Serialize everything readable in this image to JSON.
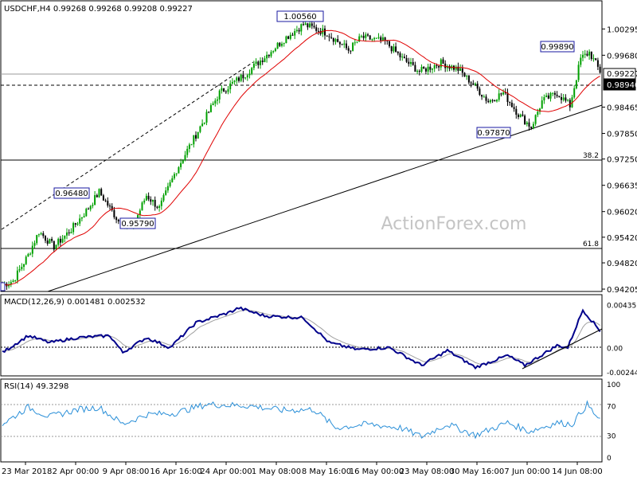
{
  "price_panel": {
    "symbol_title": "USDCHF,H4",
    "ohlc_text": "0.99268 0.99268 0.99208 0.99227",
    "price_ticks": [
      "1.00295",
      "0.99680",
      "0.99227",
      "0.98940",
      "0.98465",
      "0.97850",
      "0.97250",
      "0.96635",
      "0.96020",
      "0.95420",
      "0.94820",
      "0.94205"
    ],
    "current_price": "0.99227",
    "level_line_price": "0.98940",
    "fib_38": "38.2",
    "fib_61": "61.8",
    "callouts": [
      "1.00560",
      "0.99890",
      "0.96480",
      "0.95790",
      "0.97870"
    ],
    "watermark": "ActionForex.com"
  },
  "macd_panel": {
    "title": "MACD(12,26,9) 0.001481 0.002532",
    "ticks": [
      "0.004351",
      "0.00",
      "-0.002448"
    ]
  },
  "rsi_panel": {
    "title": "RSI(14) 49.3298",
    "ticks": [
      "100",
      "70",
      "30",
      "0"
    ]
  },
  "time_axis": [
    "23 Mar 2018",
    "2 Apr 00:00",
    "9 Apr 08:00",
    "16 Apr 16:00",
    "24 Apr 00:00",
    "1 May 08:00",
    "8 May 16:00",
    "16 May 00:00",
    "23 May 08:00",
    "30 May 16:00",
    "7 Jun 00:00",
    "14 Jun 08:00"
  ],
  "colors": {
    "up_candle": "#00a000",
    "moving_average": "#e00000",
    "macd_line": "#00008b",
    "signal_line": "#a0a0a0",
    "rsi_line": "#2a8fd8",
    "callout_border": "#1a1aa0"
  },
  "chart_data": [
    {
      "type": "candlestick",
      "title": "USDCHF,H4",
      "ylim": [
        0.9415,
        1.006
      ],
      "anchors": [
        {
          "x": 0,
          "y": 0.943
        },
        {
          "x": 5,
          "y": 0.944
        },
        {
          "x": 12,
          "y": 0.95
        },
        {
          "x": 17,
          "y": 0.9555
        },
        {
          "x": 24,
          "y": 0.952
        },
        {
          "x": 32,
          "y": 0.956
        },
        {
          "x": 40,
          "y": 0.961
        },
        {
          "x": 45,
          "y": 0.9648
        },
        {
          "x": 54,
          "y": 0.958
        },
        {
          "x": 60,
          "y": 0.956
        },
        {
          "x": 67,
          "y": 0.964
        },
        {
          "x": 73,
          "y": 0.961
        },
        {
          "x": 81,
          "y": 0.97
        },
        {
          "x": 92,
          "y": 0.98
        },
        {
          "x": 101,
          "y": 0.988
        },
        {
          "x": 112,
          "y": 0.992
        },
        {
          "x": 121,
          "y": 0.996
        },
        {
          "x": 132,
          "y": 1.001
        },
        {
          "x": 140,
          "y": 1.004
        },
        {
          "x": 151,
          "y": 1.002
        },
        {
          "x": 161,
          "y": 0.998
        },
        {
          "x": 167,
          "y": 1.001
        },
        {
          "x": 178,
          "y": 1.0
        },
        {
          "x": 186,
          "y": 0.996
        },
        {
          "x": 194,
          "y": 0.993
        },
        {
          "x": 204,
          "y": 0.995
        },
        {
          "x": 212,
          "y": 0.9935
        },
        {
          "x": 219,
          "y": 0.99
        },
        {
          "x": 226,
          "y": 0.986
        },
        {
          "x": 233,
          "y": 0.988
        },
        {
          "x": 240,
          "y": 0.983
        },
        {
          "x": 246,
          "y": 0.98
        },
        {
          "x": 251,
          "y": 0.986
        },
        {
          "x": 258,
          "y": 0.988
        },
        {
          "x": 264,
          "y": 0.985
        },
        {
          "x": 269,
          "y": 0.996
        },
        {
          "x": 273,
          "y": 0.9975
        },
        {
          "x": 278,
          "y": 0.993
        }
      ]
    },
    {
      "type": "line",
      "title": "MACD(12,26,9)",
      "ylim": [
        -0.0027,
        0.0047
      ],
      "anchors": [
        {
          "x": 0,
          "y": -0.0005
        },
        {
          "x": 12,
          "y": 0.0012
        },
        {
          "x": 22,
          "y": 0.0005
        },
        {
          "x": 35,
          "y": 0.001
        },
        {
          "x": 50,
          "y": 0.0012
        },
        {
          "x": 56,
          "y": -0.0005
        },
        {
          "x": 67,
          "y": 0.001
        },
        {
          "x": 78,
          "y": 0.0
        },
        {
          "x": 90,
          "y": 0.0025
        },
        {
          "x": 105,
          "y": 0.0035
        },
        {
          "x": 110,
          "y": 0.004
        },
        {
          "x": 122,
          "y": 0.0032
        },
        {
          "x": 140,
          "y": 0.003
        },
        {
          "x": 152,
          "y": 0.0005
        },
        {
          "x": 165,
          "y": -0.0002
        },
        {
          "x": 180,
          "y": 0.0
        },
        {
          "x": 195,
          "y": -0.0018
        },
        {
          "x": 207,
          "y": -0.0003
        },
        {
          "x": 220,
          "y": -0.002
        },
        {
          "x": 235,
          "y": -0.0008
        },
        {
          "x": 243,
          "y": -0.0018
        },
        {
          "x": 258,
          "y": 0.0002
        },
        {
          "x": 263,
          "y": 0.0
        },
        {
          "x": 270,
          "y": 0.0038
        },
        {
          "x": 278,
          "y": 0.0017
        }
      ]
    },
    {
      "type": "line",
      "title": "RSI(14)",
      "ylim": [
        0,
        100
      ],
      "anchors": [
        {
          "x": 0,
          "y": 45
        },
        {
          "x": 12,
          "y": 68
        },
        {
          "x": 22,
          "y": 55
        },
        {
          "x": 35,
          "y": 65
        },
        {
          "x": 45,
          "y": 68
        },
        {
          "x": 56,
          "y": 45
        },
        {
          "x": 67,
          "y": 58
        },
        {
          "x": 80,
          "y": 60
        },
        {
          "x": 95,
          "y": 72
        },
        {
          "x": 115,
          "y": 70
        },
        {
          "x": 130,
          "y": 64
        },
        {
          "x": 145,
          "y": 65
        },
        {
          "x": 155,
          "y": 40
        },
        {
          "x": 170,
          "y": 45
        },
        {
          "x": 185,
          "y": 40
        },
        {
          "x": 195,
          "y": 28
        },
        {
          "x": 207,
          "y": 45
        },
        {
          "x": 220,
          "y": 30
        },
        {
          "x": 235,
          "y": 47
        },
        {
          "x": 245,
          "y": 35
        },
        {
          "x": 258,
          "y": 47
        },
        {
          "x": 265,
          "y": 45
        },
        {
          "x": 272,
          "y": 72
        },
        {
          "x": 278,
          "y": 49
        }
      ]
    }
  ]
}
